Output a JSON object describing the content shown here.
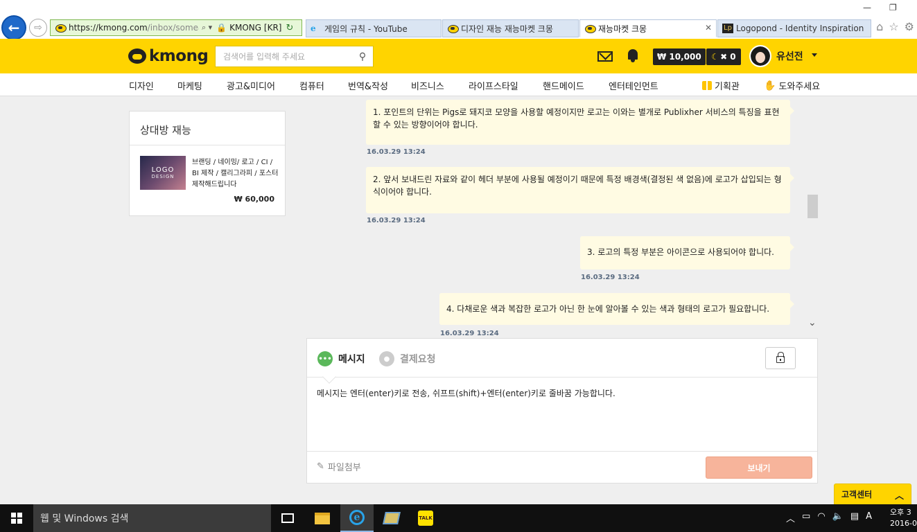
{
  "browser": {
    "address": {
      "url_main": "https://kmong.com",
      "url_rest": "/inbox/someag",
      "tools": "⌕ ▾",
      "site_id": "KMONG [KR]"
    },
    "tabs": [
      {
        "label": "게임의 규칙 - YouTube",
        "icon": "ie-icon"
      },
      {
        "label": "디자인 재능 재능마켓 크몽",
        "icon": "kmong-icon"
      },
      {
        "label": "재능마켓 크몽",
        "icon": "kmong-icon",
        "active": true
      },
      {
        "label": "Logopond - Identity Inspiration",
        "icon": "logopond-icon"
      }
    ]
  },
  "header": {
    "logo": "kmong",
    "search_placeholder": "검색어를 입력해 주세요",
    "cash": "₩ 10,000",
    "banana_count": "✖ 0",
    "username": "유선전"
  },
  "nav": {
    "categories": [
      "디자인",
      "마케팅",
      "광고&미디어",
      "컴퓨터",
      "번역&작성",
      "비즈니스",
      "라이프스타일",
      "핸드메이드",
      "엔터테인먼트"
    ],
    "plan": "기획관",
    "help": "도와주세요"
  },
  "sidebar": {
    "title": "상대방 재능",
    "gig": {
      "thumb_line1": "LOGO",
      "thumb_line2": "DESIGN",
      "title": "브랜딩 / 네이밍/ 로고 / CI / BI 제작 / 캘리그라피 / 포스터 제작해드립니다",
      "price": "₩ 60,000"
    }
  },
  "messages": [
    {
      "text": "1. 포인트의 단위는 Pigs로 돼지코 모양을 사용할 예정이지만 로고는 이와는 별개로 Publixher 서비스의 특징을 표현할 수 있는 방향이어야 합니다.",
      "time": "16.03.29 13:24"
    },
    {
      "text": "2. 앞서 보내드린 자료와 같이 헤더 부분에 사용될 예정이기 때문에 특정 배경색(결정된 색 없음)에 로고가 삽입되는 형식이어야 합니다.",
      "time": "16.03.29 13:24"
    },
    {
      "text": "3. 로고의 특정 부분은 아이콘으로 사용되어야 합니다.",
      "time": "16.03.29 13:24"
    },
    {
      "text": "4. 다채로운 색과 복잡한 로고가 아닌 한 눈에 알아볼 수 있는 색과 형태의 로고가 필요합니다.",
      "time": "16.03.29 13:24"
    }
  ],
  "composer": {
    "tab_message": "메시지",
    "tab_payment": "결제요청",
    "text": "메시지는 엔터(enter)키로 전송, 쉬프트(shift)+엔터(enter)키로 줄바꿈 가능합니다.",
    "attach": "파일첨부",
    "send": "보내기"
  },
  "support": {
    "label": "고객센터"
  },
  "taskbar": {
    "search": "웹 및 Windows 검색",
    "time": "오후 3",
    "date": "2016-0"
  },
  "colors": {
    "brand_yellow": "#ffd400",
    "bubble_bg": "#fffbe3",
    "send_button": "#f7b49b",
    "active_tab_green": "#5bb85b"
  }
}
